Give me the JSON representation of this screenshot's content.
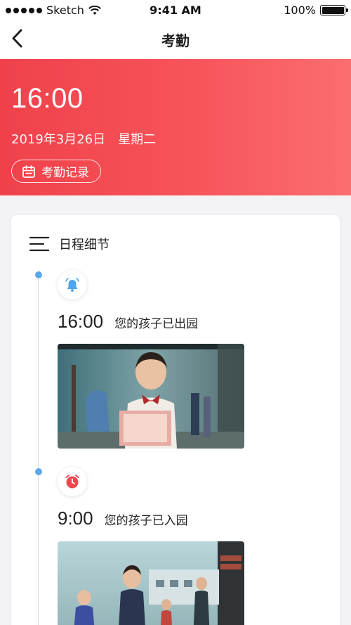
{
  "status_bar": {
    "carrier": "Sketch",
    "time": "9:41 AM",
    "battery": "100%"
  },
  "nav": {
    "title": "考勤"
  },
  "hero": {
    "time": "16:00",
    "date": "2019年3月26日",
    "weekday": "星期二",
    "record_button": "考勤记录"
  },
  "schedule": {
    "title": "日程细节",
    "events": [
      {
        "icon": "bell-icon",
        "time": "16:00",
        "text": "您的孩子已出园"
      },
      {
        "icon": "alarm-clock-icon",
        "time": "9:00",
        "text": "您的孩子已入园"
      }
    ]
  },
  "colors": {
    "accent": "#f24a52",
    "timeline_dot": "#5aa8e8"
  }
}
